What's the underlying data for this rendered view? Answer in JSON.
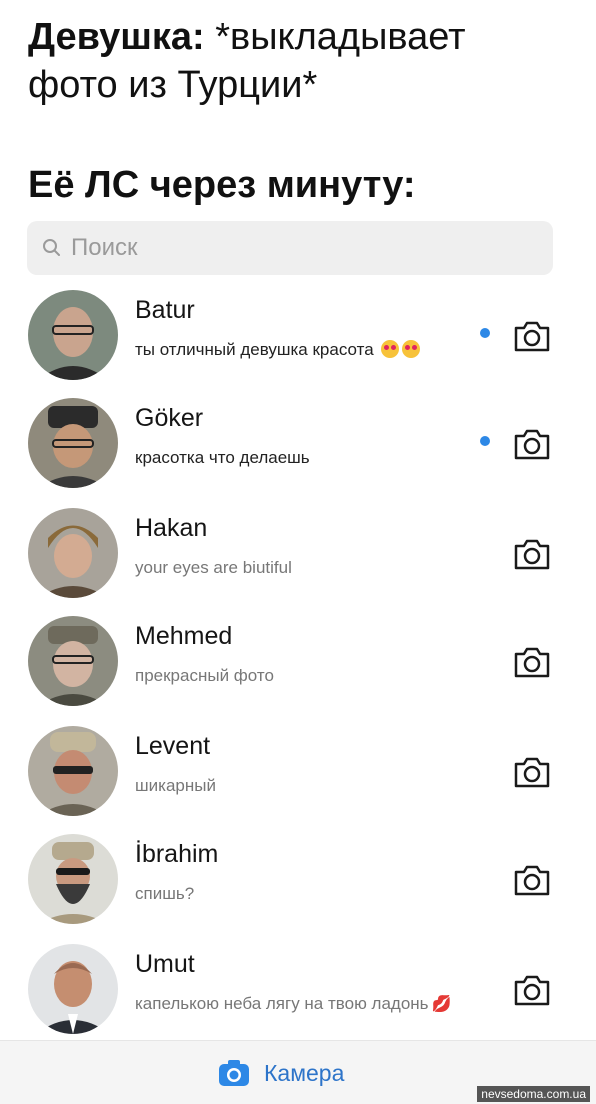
{
  "caption": {
    "line1_bold": "Девушка:",
    "line1_rest": " *выкладывает",
    "line2": "фото из Турции*",
    "line3": "Её ЛС через минуту:"
  },
  "search": {
    "placeholder": "Поиск",
    "icon": "search-icon"
  },
  "chats": [
    {
      "name": "Batur",
      "message": "ты отличный девушка красота",
      "unread": true,
      "emoji": "heart-eyes"
    },
    {
      "name": "Göker",
      "message": "красотка что делаешь",
      "unread": true
    },
    {
      "name": "Hakan",
      "message": "your eyes are biutiful",
      "unread": false
    },
    {
      "name": "Mehmed",
      "message": "прекрасный фото",
      "unread": false
    },
    {
      "name": "Levent",
      "message": "шикарный",
      "unread": false
    },
    {
      "name": "İbrahim",
      "message": "спишь?",
      "unread": false
    },
    {
      "name": "Umut",
      "message": "капелькою неба лягу на твою ладонь",
      "unread": false,
      "emoji": "kiss-mark"
    }
  ],
  "bottom_bar": {
    "camera_label": "Камера"
  },
  "watermark": "nevsedoma.com.ua",
  "colors": {
    "accent": "#2d74c9",
    "unread_dot": "#2d88e6",
    "search_bg": "#efefef"
  }
}
